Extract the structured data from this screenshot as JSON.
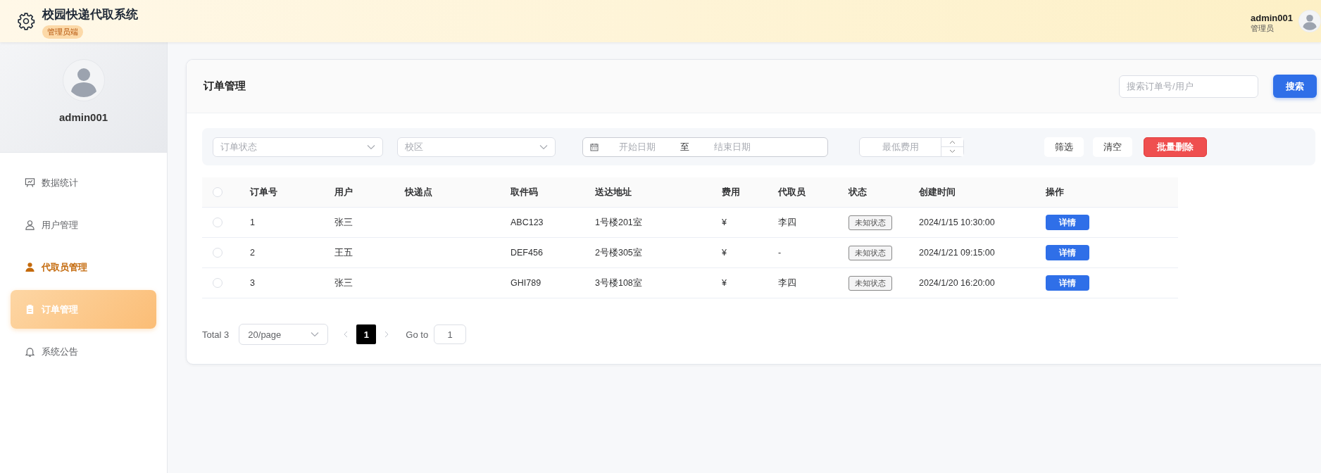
{
  "header": {
    "title": "校园快递代取系统",
    "badge": "管理员端",
    "user_name": "admin001",
    "user_role": "管理员"
  },
  "sidebar": {
    "profile_name": "admin001",
    "items": [
      {
        "label": "数据统计",
        "selected": false,
        "hovered": false
      },
      {
        "label": "用户管理",
        "selected": false,
        "hovered": false
      },
      {
        "label": "代取员管理",
        "selected": false,
        "hovered": true
      },
      {
        "label": "订单管理",
        "selected": true,
        "hovered": false
      },
      {
        "label": "系统公告",
        "selected": false,
        "hovered": false
      }
    ]
  },
  "card": {
    "title": "订单管理",
    "search": {
      "placeholder": "搜索订单号/用户"
    },
    "search_button": "搜索"
  },
  "filters": {
    "status": {
      "placeholder": "订单状态"
    },
    "campus": {
      "placeholder": "校区"
    },
    "date_range": {
      "start_placeholder": "开始日期",
      "separator": "至",
      "end_placeholder": "结束日期"
    },
    "min_fee": {
      "placeholder": "最低费用"
    },
    "buttons": [
      {
        "label": "筛选",
        "kind": "plain"
      },
      {
        "label": "清空",
        "kind": "plain"
      },
      {
        "label": "批量删除",
        "kind": "danger"
      }
    ]
  },
  "table": {
    "select_all_checked": false,
    "columns": [
      "订单号",
      "用户",
      "快递点",
      "取件码",
      "送达地址",
      "费用",
      "代取员",
      "状态",
      "创建时间",
      "操作"
    ],
    "rows": [
      {
        "checked": false,
        "order_no": "1",
        "user": "张三",
        "pickup_code": "ABC123",
        "address": "1号楼201室",
        "fee": "¥",
        "courier": "李四",
        "status": "未知状态",
        "created": "2024/1/15 10:30:00",
        "action": "详情"
      },
      {
        "checked": false,
        "order_no": "2",
        "user": "王五",
        "pickup_code": "DEF456",
        "address": "2号楼305室",
        "fee": "¥",
        "courier": "-",
        "status": "未知状态",
        "created": "2024/1/21 09:15:00",
        "action": "详情"
      },
      {
        "checked": false,
        "order_no": "3",
        "user": "张三",
        "pickup_code": "GHI789",
        "address": "3号楼108室",
        "fee": "¥",
        "courier": "李四",
        "status": "未知状态",
        "created": "2024/1/20 16:20:00",
        "action": "详情"
      }
    ]
  },
  "pagination": {
    "total": "Total 3",
    "page_size": "20/page",
    "pages": [
      {
        "label": "1",
        "selected": true
      }
    ],
    "goto_label": "Go to",
    "goto_value": "1"
  }
}
